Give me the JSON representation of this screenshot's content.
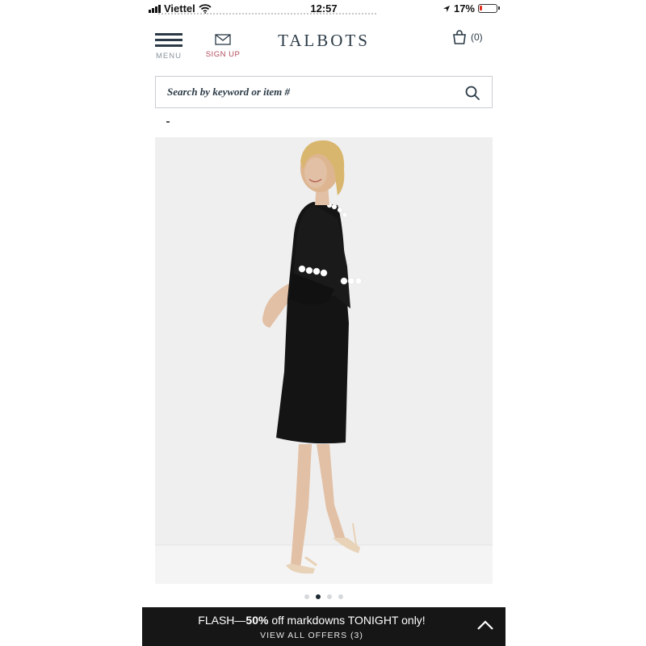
{
  "status_bar": {
    "carrier": "Viettel",
    "time": "12:57",
    "battery": "17%",
    "battery_level": 0.17
  },
  "header": {
    "menu_label": "MENU",
    "signup_label": "SIGN UP",
    "logo": "TALBOTS",
    "bag_count": "(0)"
  },
  "search": {
    "placeholder": "Search by keyword or item #"
  },
  "product": {
    "image_count": 4,
    "active_image": 2
  },
  "offer": {
    "prefix": "FLASH—",
    "highlight": "50%",
    "suffix": " off markdowns TONIGHT only!",
    "view_label": "VIEW ALL OFFERS",
    "view_count": "(3)"
  },
  "colors": {
    "brand_text": "#2b3a46",
    "signup_accent": "#b04a5a",
    "offer_bar": "#161616"
  }
}
